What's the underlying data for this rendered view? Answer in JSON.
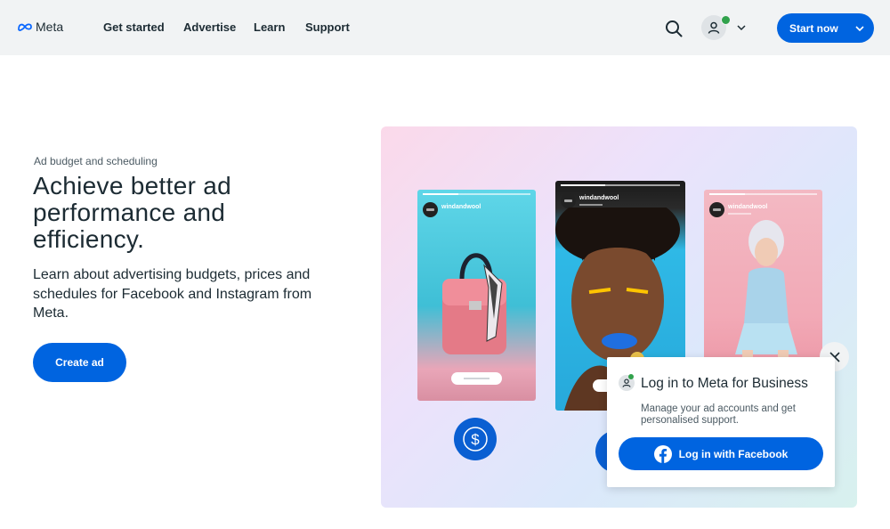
{
  "header": {
    "logo_text": "Meta",
    "nav": [
      {
        "label": "Get started"
      },
      {
        "label": "Advertise"
      },
      {
        "label": "Learn"
      },
      {
        "label": "Support"
      }
    ],
    "cta_label": "Start now",
    "icons": {
      "search": "search-icon",
      "account": "account-icon",
      "chevron": "chevron-down-icon"
    }
  },
  "hero": {
    "eyebrow": "Ad budget and scheduling",
    "title": "Achieve better ad performance and efficiency.",
    "description": "Learn about advertising budgets, prices and schedules for Facebook and Instagram from Meta.",
    "cta_label": "Create ad"
  },
  "illustration": {
    "stories": [
      {
        "handle": "windandwool"
      },
      {
        "handle": "windandwool"
      },
      {
        "handle": "windandwool"
      }
    ],
    "coin_icon": "dollar-icon"
  },
  "popup": {
    "title": "Log in to Meta for Business",
    "description": "Manage your ad accounts and get personalised support.",
    "button_label": "Log in with Facebook",
    "close_icon": "close-icon"
  },
  "colors": {
    "brand_blue": "#0064e0",
    "header_bg": "#f1f3f4",
    "text_dark": "#1c2b33",
    "online_green": "#31a24c"
  }
}
